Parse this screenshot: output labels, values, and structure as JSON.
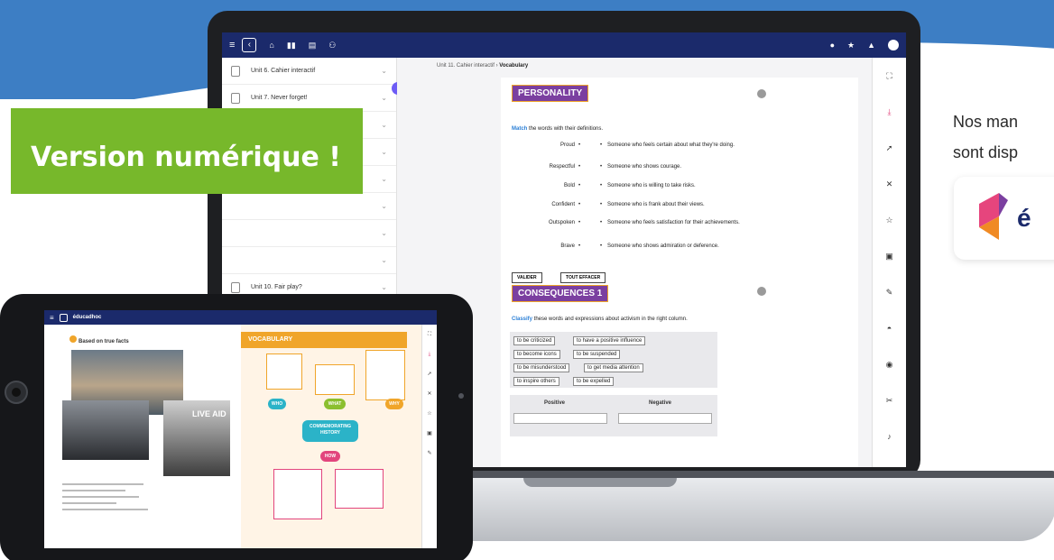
{
  "banner": {
    "text": "Version numérique !"
  },
  "side_text": {
    "line1": "Nos man",
    "line2": "sont disp"
  },
  "logo": {
    "glyph": "é"
  },
  "app": {
    "breadcrumb": {
      "parent": "Unit 11. Cahier interactif",
      "separator": " › ",
      "current": "Vocabulary"
    },
    "sidebar": {
      "items": [
        {
          "label": "Unit 6. Cahier interactif"
        },
        {
          "label": "Unit 7. Never forget!"
        },
        {
          "label": ""
        },
        {
          "label": ""
        },
        {
          "label": ""
        },
        {
          "label": ""
        },
        {
          "label": ""
        },
        {
          "label": ""
        },
        {
          "label": "Unit 10. Fair play?"
        }
      ]
    },
    "section1": {
      "title": "PERSONALITY",
      "instruction_kw": "Match",
      "instruction_rest": " the words with their definitions.",
      "rows": [
        {
          "word": "Proud",
          "def": "Someone who feels certain about what they're doing."
        },
        {
          "word": "Respectful",
          "def": "Someone who shows courage."
        },
        {
          "word": "Bold",
          "def": "Someone who is willing to take risks."
        },
        {
          "word": "Confident",
          "def": "Someone who is frank about their views."
        },
        {
          "word": "Outspoken",
          "def": "Someone who feels satisfaction for their achievements."
        },
        {
          "word": "Brave",
          "def": "Someone who shows admiration or deference."
        }
      ],
      "validate": "VALIDER",
      "clear": "TOUT EFFACER"
    },
    "section2": {
      "title": "CONSEQUENCES 1",
      "instruction_kw": "Classify",
      "instruction_rest": " these words and expressions about activism in the right column.",
      "chips": [
        "to be criticized",
        "to have a positive influence",
        "to become icons",
        "to be suspended",
        "to be misunderstood",
        "to get media attention",
        "to inspire others",
        "to be expelled"
      ],
      "col_positive": "Positive",
      "col_negative": "Negative"
    }
  },
  "tablet": {
    "brand": "éducadhoc",
    "heading": "Based on true facts",
    "vocab": "VOCABULARY",
    "node_main": "COMMEMORATING HISTORY",
    "node_who": "WHO",
    "node_what": "WHAT",
    "node_why": "WHY",
    "node_how": "HOW",
    "photo_caption": "LIVE AID"
  }
}
